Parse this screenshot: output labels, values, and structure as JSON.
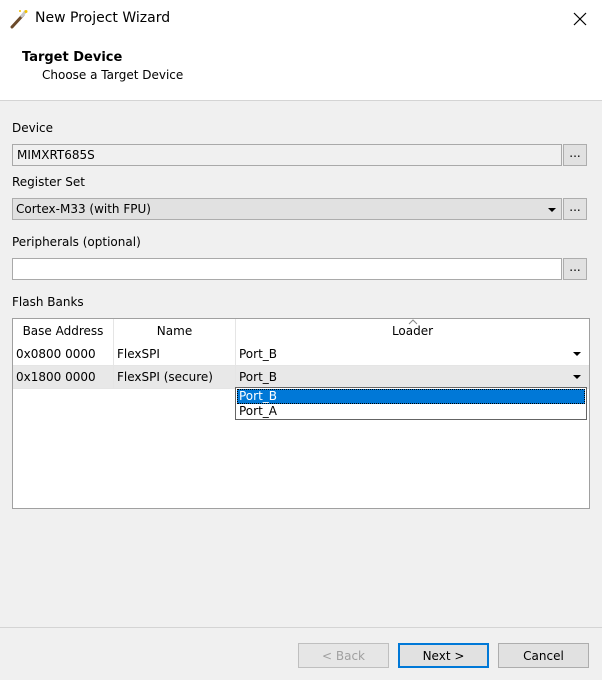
{
  "window": {
    "title": "New Project Wizard",
    "icons": {
      "app": "magic-wand-icon",
      "close": "close-icon"
    }
  },
  "header": {
    "title": "Target Device",
    "subtitle": "Choose a Target Device"
  },
  "device": {
    "label": "Device",
    "value": "MIMXRT685S",
    "browse_label": "..."
  },
  "register_set": {
    "label": "Register Set",
    "value": "Cortex-M33 (with FPU)",
    "browse_label": "..."
  },
  "peripherals": {
    "label": "Peripherals (optional)",
    "value": "",
    "browse_label": "..."
  },
  "flash_banks": {
    "label": "Flash Banks",
    "columns": [
      "Base Address",
      "Name",
      "Loader"
    ],
    "rows": [
      {
        "base_address": "0x0800 0000",
        "name": "FlexSPI",
        "loader": "Port_B"
      },
      {
        "base_address": "0x1800 0000",
        "name": "FlexSPI (secure)",
        "loader": "Port_B"
      }
    ],
    "loader_options": [
      "Port_B",
      "Port_A"
    ],
    "selected_option": "Port_B"
  },
  "footer": {
    "back_label": "< Back",
    "next_label": "Next >",
    "cancel_label": "Cancel"
  },
  "colors": {
    "selection": "#0078d7",
    "background": "#f0f0f0"
  }
}
